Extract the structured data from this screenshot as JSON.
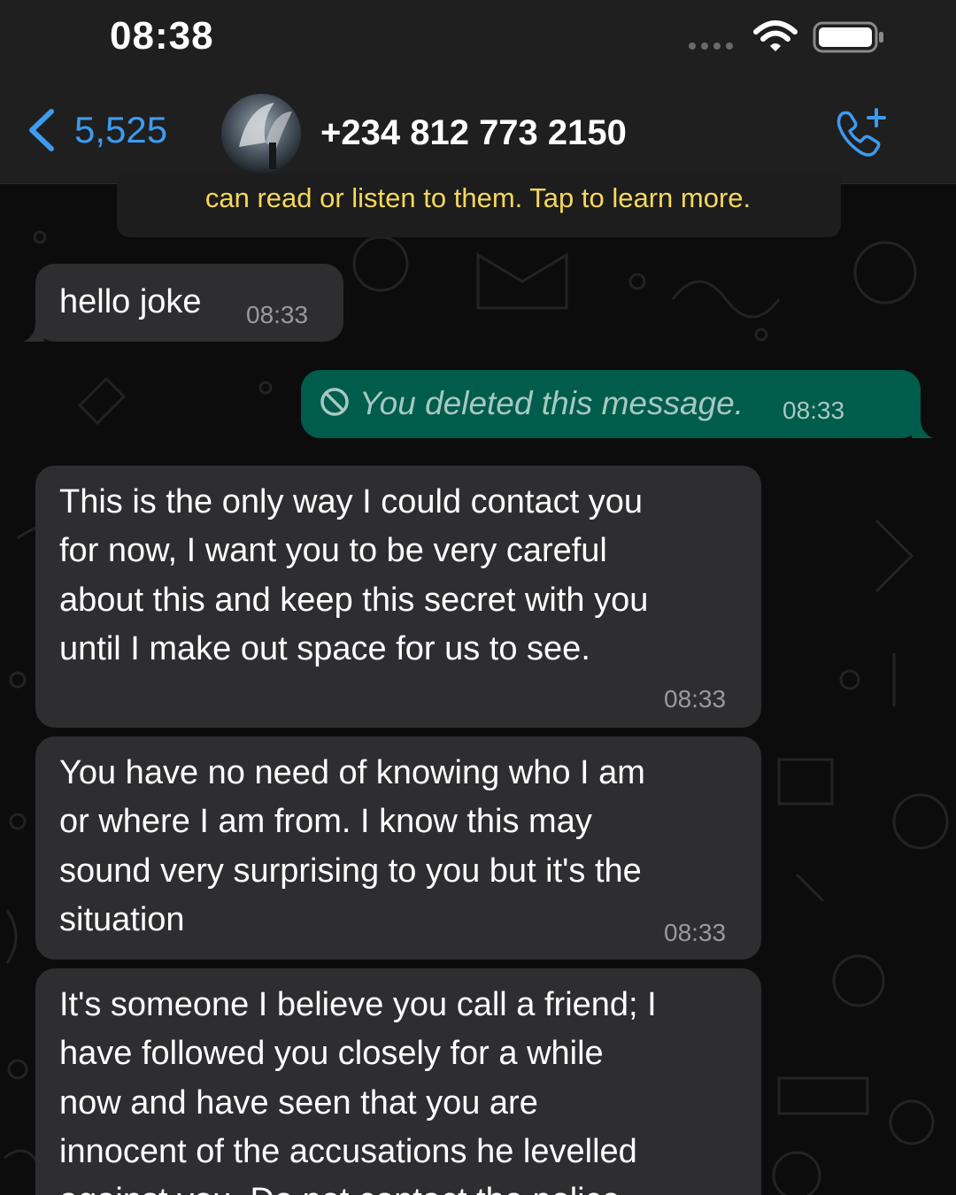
{
  "status_bar": {
    "time": "08:38"
  },
  "header": {
    "back_label": "5,525",
    "contact_name": "+234 812 773 2150"
  },
  "encryption_notice": "can read or listen to them. Tap to learn more.",
  "messages": [
    {
      "direction": "incoming",
      "text": "hello joke",
      "time": "08:33"
    },
    {
      "direction": "outgoing",
      "text": "You deleted this message.",
      "time": "08:33",
      "deleted": true
    },
    {
      "direction": "incoming",
      "lines": [
        "This is the only way I could contact you",
        "for now, I want you to be very careful",
        "about this and keep this secret with you",
        "until I make out space for us to see."
      ],
      "time": "08:33"
    },
    {
      "direction": "incoming",
      "lines": [
        "You have no need of knowing who I am",
        "or where I am from. I know this may",
        "sound very surprising to you but it's the",
        "situation"
      ],
      "time": "08:33"
    },
    {
      "direction": "incoming",
      "lines": [
        "It's someone I believe you call a friend; I",
        "have followed you closely for a while",
        "now and have seen that you are",
        "innocent of the accusations he levelled",
        "against you. Do not contact the police"
      ],
      "time": ""
    }
  ],
  "colors": {
    "accent_blue": "#3d9bf0",
    "outgoing_bubble": "#005c4b",
    "incoming_bubble": "#2e2e30",
    "notice_yellow": "#f5d85a"
  },
  "icons": {
    "back": "chevron-left-icon",
    "call": "add-call-icon",
    "deleted": "prohibited-icon",
    "wifi": "wifi-icon",
    "battery": "battery-icon"
  }
}
